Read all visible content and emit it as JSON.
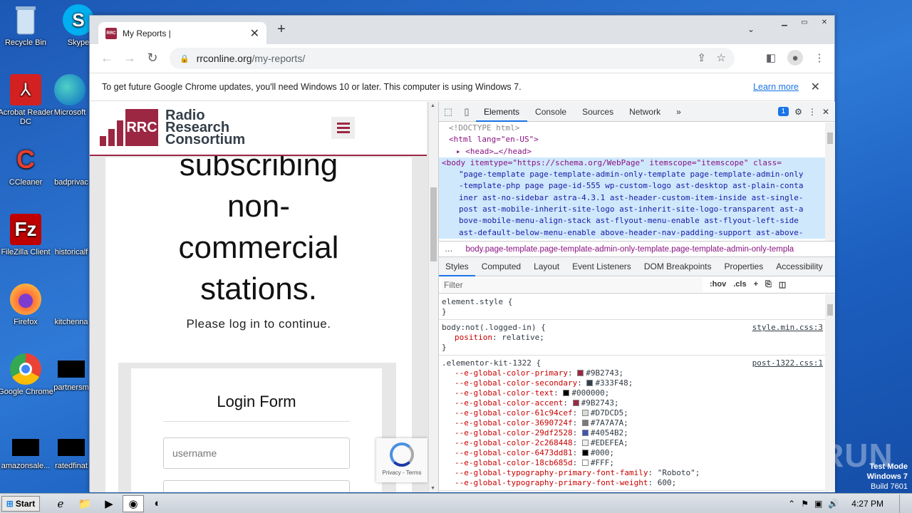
{
  "desktop": {
    "icons": [
      {
        "label": "Recycle Bin",
        "icon": "recycle-bin-icon"
      },
      {
        "label": "Skype",
        "icon": "skype-icon"
      },
      {
        "label": "Acrobat Reader DC",
        "icon": "acrobat-icon"
      },
      {
        "label": "Microsoft",
        "icon": "edge-icon"
      },
      {
        "label": "CCleaner",
        "icon": "ccleaner-icon"
      },
      {
        "label": "badprivac",
        "icon": "document-icon"
      },
      {
        "label": "FileZilla Client",
        "icon": "filezilla-icon"
      },
      {
        "label": "historicalf",
        "icon": "document-icon"
      },
      {
        "label": "Firefox",
        "icon": "firefox-icon"
      },
      {
        "label": "kitchenna",
        "icon": "document-icon"
      },
      {
        "label": "Google Chrome",
        "icon": "chrome-icon"
      },
      {
        "label": "partnersm",
        "icon": "document-icon"
      },
      {
        "label": "amazonsale...",
        "icon": "document-icon"
      },
      {
        "label": "ratedfinat",
        "icon": "document-icon"
      }
    ],
    "watermark": "ANY RUN",
    "test_mode": {
      "line1": "Test Mode",
      "line2": "Windows 7",
      "line3": "Build 7601"
    }
  },
  "browser": {
    "tab_title": "My Reports |",
    "favicon_text": "RRC",
    "url_host": "rrconline.org",
    "url_path": "/my-reports/",
    "infobar": {
      "message": "To get future Google Chrome updates, you'll need Windows 10 or later. This computer is using Windows 7.",
      "link": "Learn more"
    }
  },
  "site": {
    "logo_abbr": "RRC",
    "logo_name": [
      "Radio",
      "Research",
      "Consortium"
    ],
    "hero_lines": [
      "subscribing",
      "non-",
      "commercial",
      "stations."
    ],
    "subtitle": "Please log in to continue.",
    "login_title": "Login Form",
    "username_placeholder": "username",
    "recaptcha": "Privacy - Terms"
  },
  "devtools": {
    "tabs": [
      "Elements",
      "Console",
      "Sources",
      "Network"
    ],
    "active_tab": "Elements",
    "issues_count": "1",
    "dom": {
      "doctype": "<!DOCTYPE html>",
      "html_open": "<html lang=\"en-US\">",
      "head": "<head>…</head>",
      "body_lines": [
        "<body itemtype=\"https://schema.org/WebPage\" itemscope=\"itemscope\" class=",
        "\"page-template page-template-admin-only-template page-template-admin-only",
        "-template-php page page-id-555 wp-custom-logo ast-desktop ast-plain-conta",
        "iner ast-no-sidebar astra-4.3.1 ast-header-custom-item-inside ast-single-",
        "post ast-mobile-inherit-site-logo ast-inherit-site-logo-transparent ast-a",
        "bove-mobile-menu-align-stack ast-flyout-menu-enable ast-flyout-left-side",
        "ast-default-below-menu-enable above-header-nav-padding-support ast-above-"
      ]
    },
    "breadcrumb": "body.page-template.page-template-admin-only-template.page-template-admin-only-templa",
    "subtabs": [
      "Styles",
      "Computed",
      "Layout",
      "Event Listeners",
      "DOM Breakpoints",
      "Properties",
      "Accessibility"
    ],
    "filter_placeholder": "Filter",
    "filter_tools": [
      ":hov",
      ".cls",
      "+"
    ],
    "rules": [
      {
        "selector": "element.style {",
        "source": "",
        "props": [],
        "close": "}"
      },
      {
        "selector": "body:not(.logged-in) {",
        "source": "style.min.css:3",
        "props": [
          {
            "name": "position",
            "value": "relative;",
            "swatch": ""
          }
        ],
        "close": "}"
      },
      {
        "selector": ".elementor-kit-1322 {",
        "source": "post-1322.css:1",
        "close": "",
        "props": [
          {
            "name": "--e-global-color-primary",
            "value": "#9B2743;",
            "swatch": "#9B2743"
          },
          {
            "name": "--e-global-color-secondary",
            "value": "#333F48;",
            "swatch": "#333F48"
          },
          {
            "name": "--e-global-color-text",
            "value": "#000000;",
            "swatch": "#000000"
          },
          {
            "name": "--e-global-color-accent",
            "value": "#9B2743;",
            "swatch": "#9B2743"
          },
          {
            "name": "--e-global-color-61c94cef",
            "value": "#D7DCD5;",
            "swatch": "#D7DCD5"
          },
          {
            "name": "--e-global-color-3690724f",
            "value": "#7A7A7A;",
            "swatch": "#7A7A7A"
          },
          {
            "name": "--e-global-color-29df2528",
            "value": "#4054B2;",
            "swatch": "#4054B2"
          },
          {
            "name": "--e-global-color-2c268448",
            "value": "#EDEFEA;",
            "swatch": "#EDEFEA"
          },
          {
            "name": "--e-global-color-6473dd81",
            "value": "#000;",
            "swatch": "#000000"
          },
          {
            "name": "--e-global-color-18cb685d",
            "value": "#FFF;",
            "swatch": "#FFFFFF"
          },
          {
            "name": "--e-global-typography-primary-font-family",
            "value": "\"Roboto\";",
            "swatch": ""
          },
          {
            "name": "--e-global-typography-primary-font-weight",
            "value": "600;",
            "swatch": ""
          }
        ]
      }
    ]
  },
  "taskbar": {
    "start_label": "Start",
    "clock": "4:27 PM"
  },
  "colors": {
    "brand": "#9B2743",
    "brand_dark": "#333F48",
    "devtools_accent": "#1A73E8"
  }
}
